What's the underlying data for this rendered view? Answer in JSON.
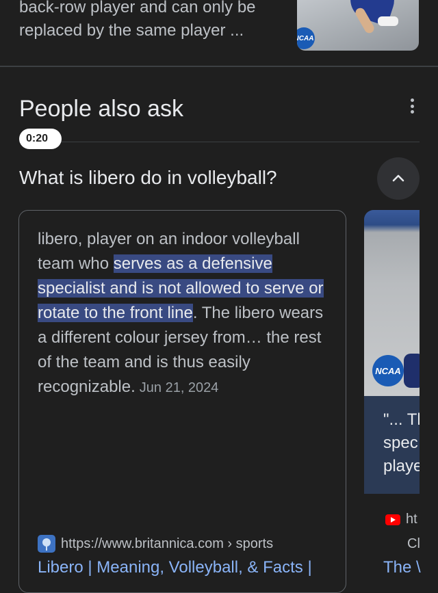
{
  "top_result": {
    "snippet_line1": "back-row player and can only be",
    "snippet_line2": "replaced by the same player ...",
    "thumbnail_badge": "NCAA"
  },
  "people_also_ask": {
    "title": "People also ask",
    "question": "What is libero do in volleyball?",
    "answer": {
      "text_before": "libero, player on an indoor volleyball team who ",
      "text_highlight": "serves as a defensive specialist and is not allowed to serve or rotate to the front line",
      "text_after": ". The libero wears a different colour jersey from… the rest of the team and is thus easily recognizable.",
      "date": "Jun 21, 2024",
      "source_url": "https://www.britannica.com › sports",
      "source_title": "Libero | Meaning, Volleyball, & Facts |"
    },
    "video": {
      "duration": "0:20",
      "thumbnail_badge": "NCAA",
      "text_line1": "\"... Th",
      "text_line2": "spec",
      "text_line3": "playe",
      "source_url": "ht",
      "channel": "Cl",
      "title": "The \\"
    }
  },
  "colors": {
    "background": "#1f1f1f",
    "highlight": "#394a82",
    "link": "#8ab4f8",
    "youtube": "#ff0000"
  }
}
